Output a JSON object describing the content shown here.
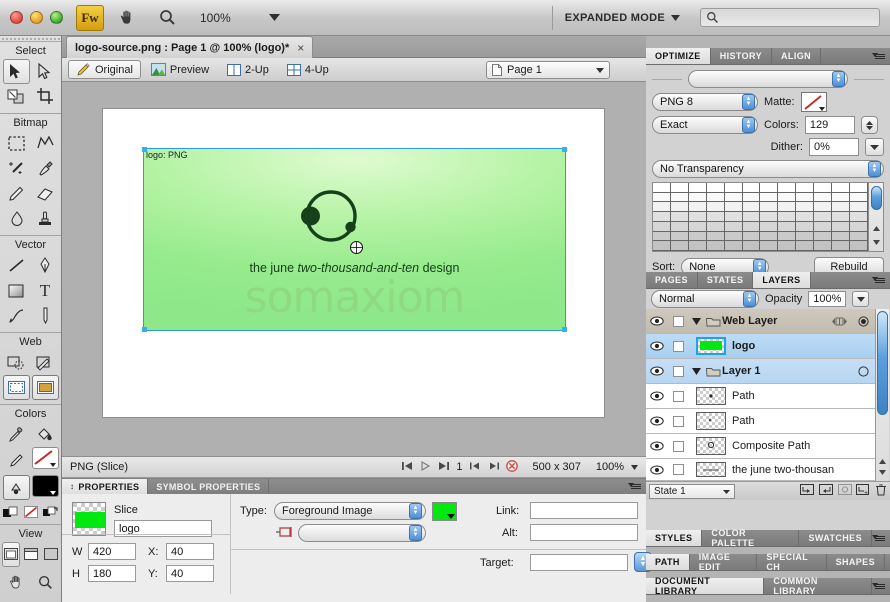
{
  "window": {
    "app_icon_label": "Fw",
    "zoom_level": "100%",
    "mode_label": "EXPANDED MODE",
    "search_placeholder": ""
  },
  "document_tab": {
    "title": "logo-source.png : Page 1 @ 100% (logo)*",
    "close_glyph": "×"
  },
  "view_bar": {
    "tabs": [
      {
        "label": "Original",
        "icon": "pencil-icon",
        "selected": true
      },
      {
        "label": "Preview",
        "icon": "image-icon",
        "selected": false
      },
      {
        "label": "2-Up",
        "icon": "split-two-icon",
        "selected": false
      },
      {
        "label": "4-Up",
        "icon": "split-four-icon",
        "selected": false
      }
    ],
    "page_selector": "Page 1"
  },
  "canvas": {
    "slice_tag": "logo: PNG",
    "tagline_prefix": "the june ",
    "tagline_italic": "two-thousand-and-ten",
    "tagline_suffix": " design",
    "wordmark": "somaxiom",
    "logo_green_light": "#b6f3a6",
    "logo_green_dark": "#16401a",
    "wordmark_color": "#8ed982"
  },
  "status_bar": {
    "object_label": "PNG (Slice)",
    "state_number": "1",
    "dimensions": "500 x 307",
    "zoom": "100%"
  },
  "properties": {
    "tabs": [
      {
        "label": "PROPERTIES",
        "selected": true
      },
      {
        "label": "SYMBOL PROPERTIES",
        "selected": false
      }
    ],
    "object_kind": "Slice",
    "object_name": "logo",
    "w_label": "W",
    "w_value": "420",
    "h_label": "H",
    "h_value": "180",
    "x_label": "X:",
    "x_value": "40",
    "y_label": "Y:",
    "y_value": "40",
    "type_label": "Type:",
    "type_value": "Foreground Image",
    "swatch_color": "#00e810",
    "link_label": "Link:",
    "link_value": "",
    "alt_label": "Alt:",
    "alt_value": "",
    "target_label": "Target:",
    "target_value": "",
    "url_value": ""
  },
  "tools": {
    "sections": [
      {
        "title": "Select",
        "rows": [
          [
            "pointer-tool",
            "subselection-tool"
          ],
          [
            "scale-tool",
            "crop-tool"
          ]
        ]
      },
      {
        "title": "Bitmap",
        "rows": [
          [
            "marquee-tool",
            "lasso-tool"
          ],
          [
            "magic-wand-tool",
            "brush-tool"
          ],
          [
            "pencil-tool",
            "eraser-tool"
          ],
          [
            "blur-tool",
            "rubber-stamp-tool"
          ]
        ]
      },
      {
        "title": "Vector",
        "rows": [
          [
            "line-tool",
            "pen-tool"
          ],
          [
            "rectangle-tool",
            "text-tool"
          ],
          [
            "freeform-tool",
            "knife-tool"
          ]
        ]
      },
      {
        "title": "Web",
        "rows": [
          [
            "hotspot-tool",
            "slice-tool"
          ],
          [
            "hide-slices-tool",
            "show-slices-tool"
          ]
        ]
      },
      {
        "title": "Colors",
        "rows": [
          [
            "eyedropper-tool",
            "paint-bucket-tool"
          ],
          [
            "stroke-color-tool",
            "fill-color-tool"
          ],
          [
            "stroke-fill-tool",
            "fill-swatch-tool"
          ],
          [
            "default-colors-tool",
            "no-color-tool",
            "swap-colors-tool"
          ]
        ]
      },
      {
        "title": "View",
        "rows": [
          [
            "standard-screen-tool",
            "full-screen-menu-tool",
            "full-screen-tool"
          ],
          [
            "hand-tool",
            "zoom-tool"
          ]
        ]
      }
    ]
  },
  "optimize_panel": {
    "tabs": [
      {
        "label": "OPTIMIZE",
        "selected": true
      },
      {
        "label": "HISTORY",
        "selected": false
      },
      {
        "label": "ALIGN",
        "selected": false
      }
    ],
    "setting_value": "",
    "format_value": "PNG 8",
    "matte_label": "Matte:",
    "palette_value": "Exact",
    "colors_label": "Colors:",
    "colors_value": "129",
    "dither_label": "Dither:",
    "dither_value": "0%",
    "transparency_value": "No Transparency",
    "sort_label": "Sort:",
    "sort_value": "None",
    "rebuild_label": "Rebuild"
  },
  "layers_panel": {
    "tabs": [
      {
        "label": "PAGES",
        "selected": false
      },
      {
        "label": "STATES",
        "selected": false
      },
      {
        "label": "LAYERS",
        "selected": true
      }
    ],
    "blend_mode": "Normal",
    "opacity_label": "Opacity",
    "opacity_value": "100%",
    "rows": [
      {
        "name": "Web Layer",
        "kind": "folder",
        "expanded": true,
        "selected": false
      },
      {
        "name": "logo",
        "kind": "slice",
        "selected": true
      },
      {
        "name": "Layer 1",
        "kind": "folder",
        "expanded": true,
        "selected": false,
        "sub": true
      },
      {
        "name": "Path",
        "kind": "object",
        "selected": false
      },
      {
        "name": "Path",
        "kind": "object",
        "selected": false
      },
      {
        "name": "Composite Path",
        "kind": "object",
        "selected": false
      },
      {
        "name": "the june two-thousan",
        "kind": "object",
        "selected": false
      }
    ],
    "state_selector": "State 1"
  },
  "bottom_panels": [
    {
      "tabs": [
        {
          "label": "STYLES",
          "selected": true
        },
        {
          "label": "COLOR PALETTE",
          "selected": false
        },
        {
          "label": "SWATCHES",
          "selected": false
        }
      ]
    },
    {
      "tabs": [
        {
          "label": "PATH",
          "selected": true
        },
        {
          "label": "IMAGE EDIT",
          "selected": false
        },
        {
          "label": "SPECIAL CH",
          "selected": false
        },
        {
          "label": "SHAPES",
          "selected": false
        }
      ]
    },
    {
      "tabs": [
        {
          "label": "DOCUMENT LIBRARY",
          "selected": true
        },
        {
          "label": "COMMON LIBRARY",
          "selected": false
        }
      ]
    }
  ]
}
